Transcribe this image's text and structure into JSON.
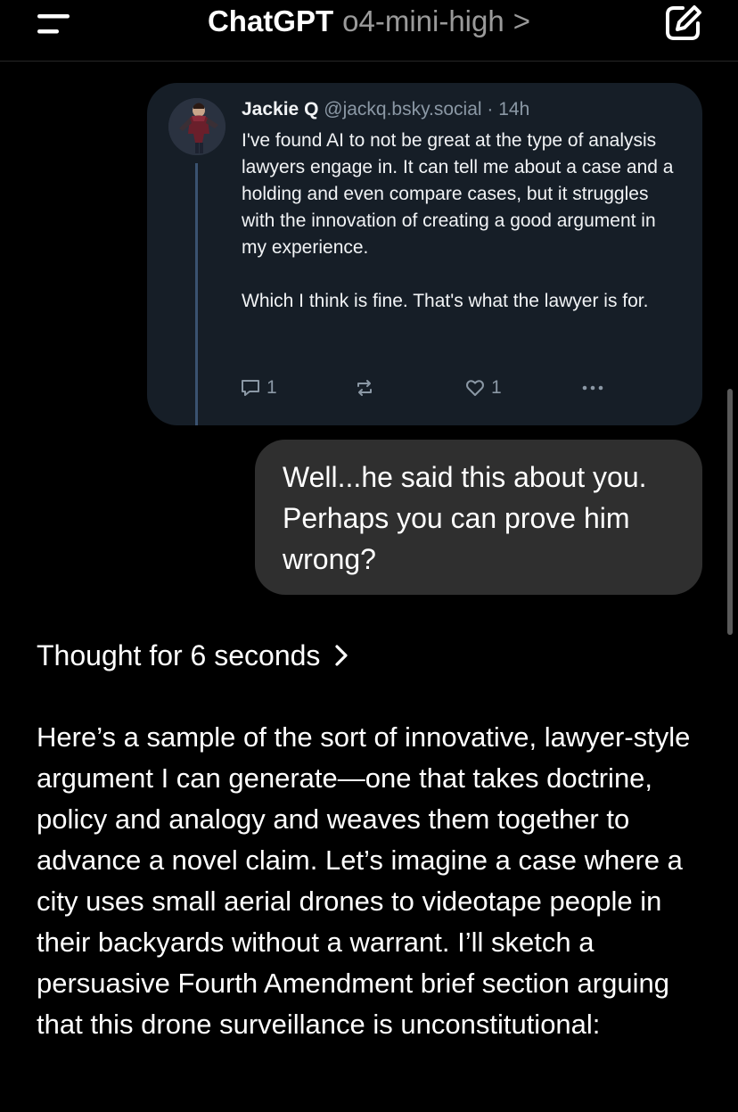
{
  "header": {
    "app_name": "ChatGPT",
    "model_name": "o4-mini-high",
    "model_chevron": ">"
  },
  "icons": {
    "menu": "menu-icon",
    "edit": "new-chat-edit-icon",
    "reply": "comment-icon",
    "repost": "repost-icon",
    "like": "heart-icon",
    "more": "more-dots-icon",
    "thought_chevron": "chevron-right-icon"
  },
  "post": {
    "author_name": "Jackie Q",
    "author_handle": "@jackq.bsky.social · 14h",
    "paragraphs": [
      "I've found AI to not be great at the type of analysis lawyers engage in. It can tell me about a case and a holding and even compare cases, but it struggles with the innovation of creating a good argument in my experience.",
      "Which I think is fine. That's what the lawyer is for."
    ],
    "reply_count": "1",
    "like_count": "1"
  },
  "user_message": {
    "text": "Well...he said this about you. Perhaps you can prove him wrong?"
  },
  "thought": {
    "label": "Thought for 6 seconds"
  },
  "assistant_message": {
    "text": "Here’s a sample of the sort of innovative, lawyer-style argument I can generate—one that takes doctrine, policy and analogy and weaves them together to advance a novel claim. Let’s imagine a case where a city uses small aerial drones to videotape people in their backyards without a warrant. I’ll sketch a persuasive Fourth Amendment brief section arguing that this drone surveillance is unconstitutional:"
  },
  "colors": {
    "background": "#000000",
    "post_card": "#161e27",
    "user_bubble": "#2f2f2f",
    "muted_text": "#9a9a9a",
    "post_muted": "#8b98a5",
    "thread_line": "#3a5270"
  }
}
